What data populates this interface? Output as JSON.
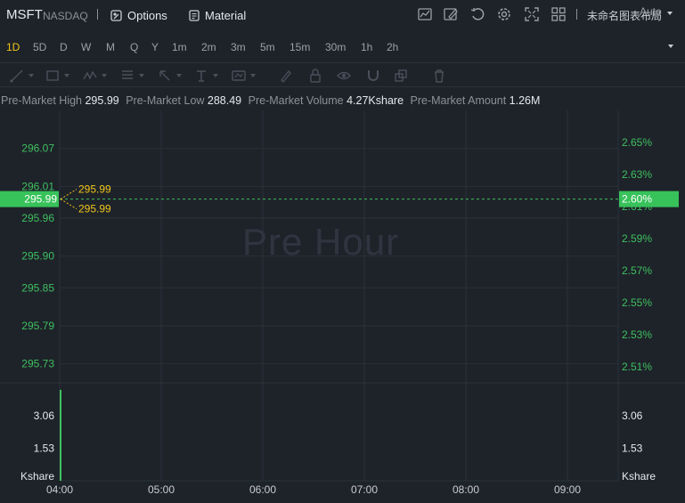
{
  "header": {
    "symbol": "MSFT",
    "exchange": "NASDAQ",
    "options_label": "Options",
    "material_label": "Material",
    "layout_name": "未命名图表布局",
    "icons": [
      "chart-icon",
      "draw-icon",
      "undo-icon",
      "settings-icon",
      "fullscreen-icon",
      "grid-layout-icon"
    ]
  },
  "periods": [
    "1D",
    "5D",
    "D",
    "W",
    "M",
    "Q",
    "Y",
    "1m",
    "2m",
    "3m",
    "5m",
    "15m",
    "30m",
    "1h",
    "2h"
  ],
  "active_period": "1D",
  "scale_mode": "Auto",
  "drawing_tools": [
    "line-tool-icon",
    "rect-tool-icon",
    "wave-tool-icon",
    "fib-tool-icon",
    "arrow-tool-icon",
    "text-tool-icon",
    "measure-tool-icon",
    "brush-icon",
    "lock-icon",
    "eye-icon",
    "magnet-icon",
    "layers-icon",
    "trash-icon"
  ],
  "stats": [
    {
      "label": "Pre-Market High",
      "value": "295.99"
    },
    {
      "label": "Pre-Market Low",
      "value": "288.49"
    },
    {
      "label": "Pre-Market Volume",
      "value": "4.27Kshare"
    },
    {
      "label": "Pre-Market Amount",
      "value": "1.26M"
    }
  ],
  "watermark": "Pre Hour",
  "colors": {
    "up": "#3fbf5f",
    "highlight_bg": "#37c25a",
    "annotation": "#f0c419",
    "grid": "#2b3139"
  },
  "chart_data": {
    "type": "line",
    "x_ticks": [
      "04:00",
      "05:00",
      "06:00",
      "07:00",
      "08:00",
      "09:00"
    ],
    "price_ticks": [
      296.07,
      296.01,
      295.96,
      295.9,
      295.85,
      295.79,
      295.73
    ],
    "price_tick_labels": [
      "296.07",
      "296.01",
      "295.96",
      "295.90",
      "295.85",
      "295.79",
      "295.73"
    ],
    "percent_ticks": [
      "2.65%",
      "2.63%",
      "2.61%",
      "2.59%",
      "2.57%",
      "2.55%",
      "2.53%",
      "2.51%"
    ],
    "percent_tick_values": [
      2.65,
      2.63,
      2.61,
      2.59,
      2.57,
      2.55,
      2.53,
      2.51
    ],
    "current_price": "295.99",
    "current_price_value": 295.99,
    "current_percent": "2.60%",
    "current_percent_value": 2.6,
    "high_marker": "295.99",
    "low_marker": "295.99",
    "volume_ticks": [
      "3.06",
      "1.53"
    ],
    "volume_tick_values": [
      3.06,
      1.53
    ],
    "volume_unit": "Kshare",
    "volume_bar": {
      "time": "04:00",
      "value": 4.27
    },
    "price_range": [
      295.7,
      296.13
    ],
    "percent_range": [
      2.5,
      2.67
    ],
    "volume_range": [
      0,
      4.6
    ]
  }
}
